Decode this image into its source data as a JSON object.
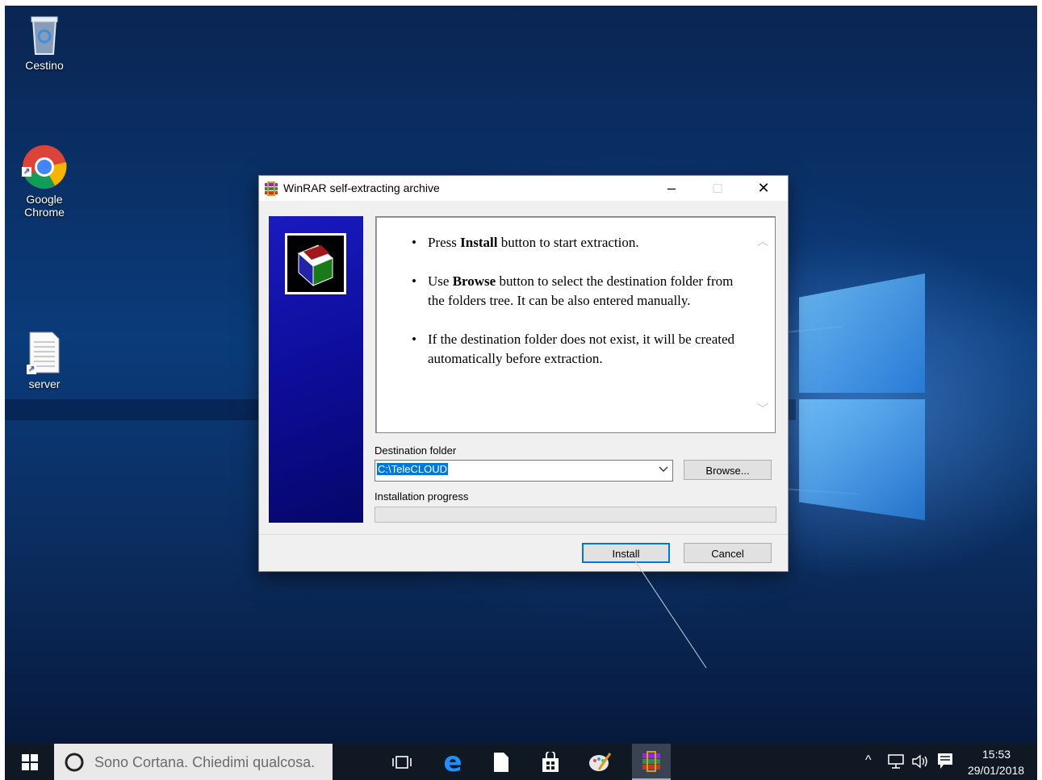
{
  "desktop": {
    "icons": [
      {
        "label": "Cestino",
        "icon": "recycle-bin-icon"
      },
      {
        "label": "Google\nChrome",
        "icon": "chrome-icon"
      },
      {
        "label": "server",
        "icon": "text-file-icon"
      }
    ]
  },
  "dialog": {
    "title": "WinRAR self-extracting archive",
    "controls": {
      "minimize": "–",
      "maximize": "□",
      "close": "✕"
    },
    "info": {
      "items": [
        {
          "pre": "Press ",
          "bold": "Install",
          "post": " button to start extraction."
        },
        {
          "pre": "Use ",
          "bold": "Browse",
          "post": " button to select the destination folder from the folders tree. It can be also entered manually."
        },
        {
          "pre": "",
          "bold": "",
          "post": "If the destination folder does not exist, it will be created automatically before extraction."
        }
      ]
    },
    "destination_label": "Destination folder",
    "destination_value": "C:\\TeleCLOUD",
    "browse_label": "Browse...",
    "progress_label": "Installation progress",
    "progress_value": 0,
    "install_label": "Install",
    "cancel_label": "Cancel"
  },
  "taskbar": {
    "search_placeholder": "Sono Cortana. Chiedimi qualcosa.",
    "pinned": [
      "task-view-icon",
      "edge-icon",
      "file-icon",
      "store-icon",
      "paint-icon",
      "winrar-icon"
    ],
    "time": "15:53",
    "date": "29/01/2018"
  }
}
